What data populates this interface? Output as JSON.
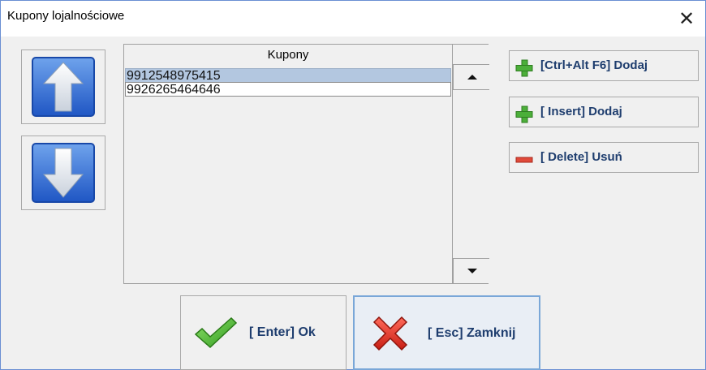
{
  "window": {
    "title": "Kupony lojalnościowe",
    "close_glyph": "✕"
  },
  "nav": {
    "up_icon": "arrow-up-icon",
    "down_icon": "arrow-down-icon"
  },
  "list": {
    "header": "Kupony",
    "rows": [
      "9912548975415",
      "9926265464646"
    ],
    "selected_index": 0
  },
  "actions": [
    {
      "label": "[Ctrl+Alt F6] Dodaj",
      "icon": "plus-icon"
    },
    {
      "label": "[ Insert] Dodaj",
      "icon": "plus-icon"
    },
    {
      "label": "[ Delete] Usuń",
      "icon": "minus-icon"
    }
  ],
  "footer": {
    "ok_label": "[ Enter] Ok",
    "ok_icon": "checkmark-icon",
    "cancel_label": "[ Esc] Zamknij",
    "cancel_icon": "x-icon"
  },
  "colors": {
    "accent_text": "#1e3d6e",
    "selection": "#b3c7e0",
    "plus_green": "#4caf3a",
    "minus_red": "#e04a3a",
    "arrow_blue": "#2f6fd6"
  }
}
